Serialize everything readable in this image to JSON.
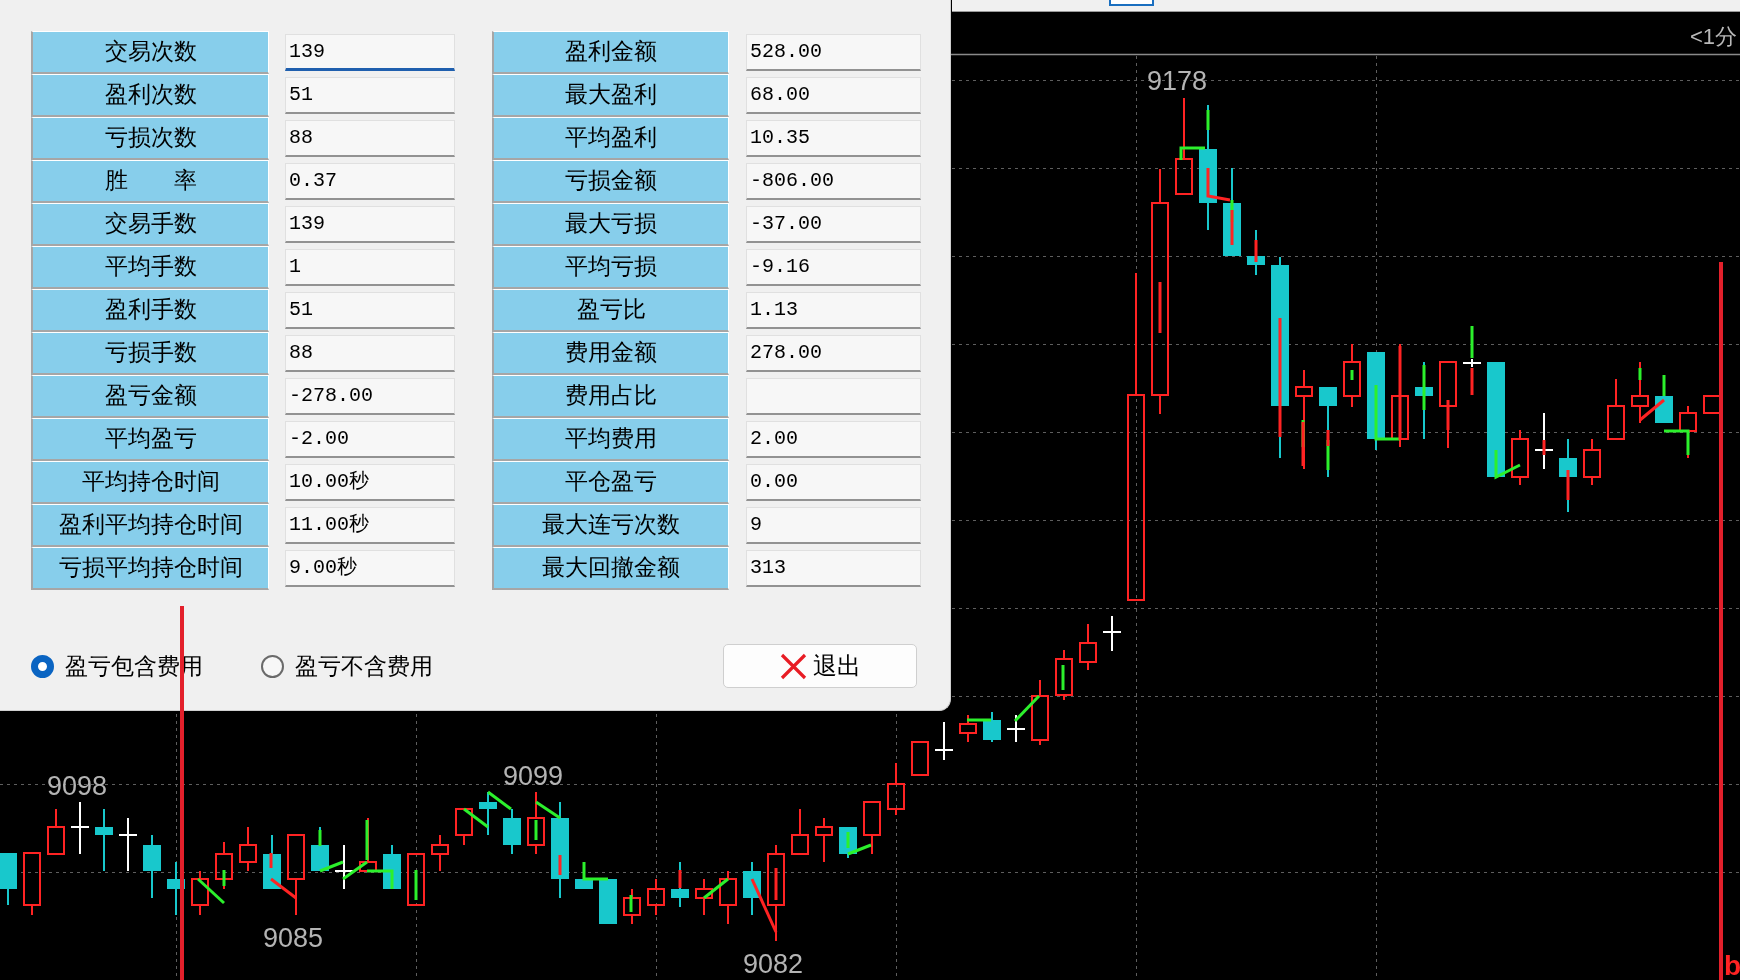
{
  "dialog": {
    "stats_left": [
      {
        "label": "交易次数",
        "value": "139",
        "focused": true
      },
      {
        "label": "盈利次数",
        "value": "51",
        "focused": false
      },
      {
        "label": "亏损次数",
        "value": "88",
        "focused": false
      },
      {
        "label": "胜　　率",
        "value": "0.37",
        "focused": false
      },
      {
        "label": "交易手数",
        "value": "139",
        "focused": false
      },
      {
        "label": "平均手数",
        "value": "1",
        "focused": false
      },
      {
        "label": "盈利手数",
        "value": "51",
        "focused": false
      },
      {
        "label": "亏损手数",
        "value": "88",
        "focused": false
      },
      {
        "label": "盈亏金额",
        "value": "-278.00",
        "focused": false
      },
      {
        "label": "平均盈亏",
        "value": "-2.00",
        "focused": false
      },
      {
        "label": "平均持仓时间",
        "value": "10.00秒",
        "focused": false
      },
      {
        "label": "盈利平均持仓时间",
        "value": "11.00秒",
        "focused": false
      },
      {
        "label": "亏损平均持仓时间",
        "value": "9.00秒",
        "focused": false
      }
    ],
    "stats_right": [
      {
        "label": "盈利金额",
        "value": "528.00",
        "focused": false
      },
      {
        "label": "最大盈利",
        "value": "68.00",
        "focused": false
      },
      {
        "label": "平均盈利",
        "value": "10.35",
        "focused": false
      },
      {
        "label": "亏损金额",
        "value": "-806.00",
        "focused": false
      },
      {
        "label": "最大亏损",
        "value": "-37.00",
        "focused": false
      },
      {
        "label": "平均亏损",
        "value": "-9.16",
        "focused": false
      },
      {
        "label": "盈亏比",
        "value": "1.13",
        "focused": false
      },
      {
        "label": "费用金额",
        "value": "278.00",
        "focused": false
      },
      {
        "label": "费用占比",
        "focused": false
      },
      {
        "label": "平均费用",
        "value": "2.00",
        "focused": false
      },
      {
        "label": "平仓盈亏",
        "value": "0.00",
        "focused": false
      },
      {
        "label": "最大连亏次数",
        "value": "9",
        "focused": false
      },
      {
        "label": "最大回撤金额",
        "value": "313",
        "focused": false
      }
    ],
    "fee_options": [
      {
        "label": "盈亏包含费用",
        "selected": true
      },
      {
        "label": "盈亏不含费用",
        "selected": false
      }
    ],
    "exit_button": {
      "label": "退出"
    }
  },
  "chart": {
    "period_label": "<1分",
    "price_labels": [
      "9178",
      "9098",
      "9099",
      "9085",
      "9082"
    ],
    "marker_label": "b"
  }
}
